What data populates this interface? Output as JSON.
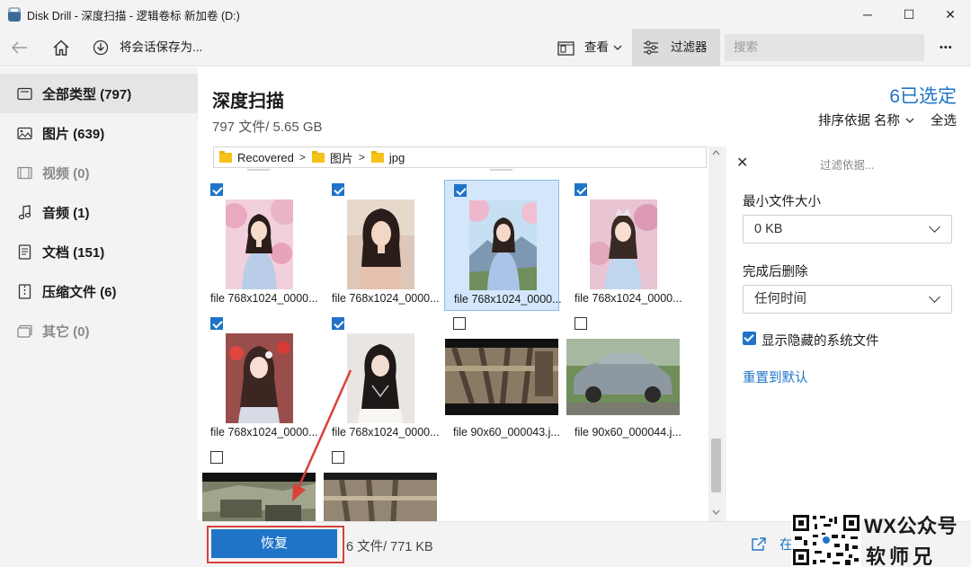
{
  "window": {
    "title": "Disk Drill - 深度扫描 - 逻辑卷标 新加卷 (D:)",
    "minimize": "─",
    "maximize": "☐",
    "close": "✕"
  },
  "toolbar": {
    "save_session": "将会话保存为...",
    "view": "查看",
    "filter": "过滤器",
    "search_placeholder": "搜索",
    "more": "•••"
  },
  "sidebar": {
    "items": [
      {
        "label": "全部类型 (797)",
        "icon": "all-types-icon"
      },
      {
        "label": "图片 (639)",
        "icon": "picture-icon"
      },
      {
        "label": "视频 (0)",
        "icon": "video-icon"
      },
      {
        "label": "音频 (1)",
        "icon": "audio-icon"
      },
      {
        "label": "文档 (151)",
        "icon": "document-icon"
      },
      {
        "label": "压缩文件 (6)",
        "icon": "archive-icon"
      },
      {
        "label": "其它 (0)",
        "icon": "other-icon"
      }
    ]
  },
  "main": {
    "title": "深度扫描",
    "subtitle": "797 文件/ 5.65 GB",
    "selected": "6已选定",
    "sort_by": "排序依据",
    "sort_field": "名称",
    "select_all": "全选"
  },
  "breadcrumb": [
    "Recovered",
    "图片",
    "jpg"
  ],
  "files": [
    {
      "name": "file 768x1024_0000...",
      "checked": true
    },
    {
      "name": "file 768x1024_0000...",
      "checked": true
    },
    {
      "name": "file 768x1024_0000...",
      "checked": true
    },
    {
      "name": "file 768x1024_0000...",
      "checked": true
    },
    {
      "name": "file 768x1024_0000...",
      "checked": true
    },
    {
      "name": "file 768x1024_0000...",
      "checked": true
    },
    {
      "name": "file 90x60_000043.j...",
      "checked": false
    },
    {
      "name": "file 90x60_000044.j...",
      "checked": false
    },
    {
      "name": "",
      "checked": false
    },
    {
      "name": "",
      "checked": false
    }
  ],
  "filter_panel": {
    "header": "过滤依据...",
    "min_size_label": "最小文件大小",
    "min_size_value": "0 KB",
    "deleted_label": "完成后删除",
    "deleted_value": "任何时间",
    "show_hidden_label": "显示隐藏的系统文件",
    "show_hidden_checked": true,
    "reset_link": "重置到默认"
  },
  "bottom": {
    "recover": "恢复",
    "stat": "6 文件/ 771 KB",
    "open": "在"
  },
  "watermark": {
    "line1": "WX公众号",
    "line2": "软师兄"
  }
}
